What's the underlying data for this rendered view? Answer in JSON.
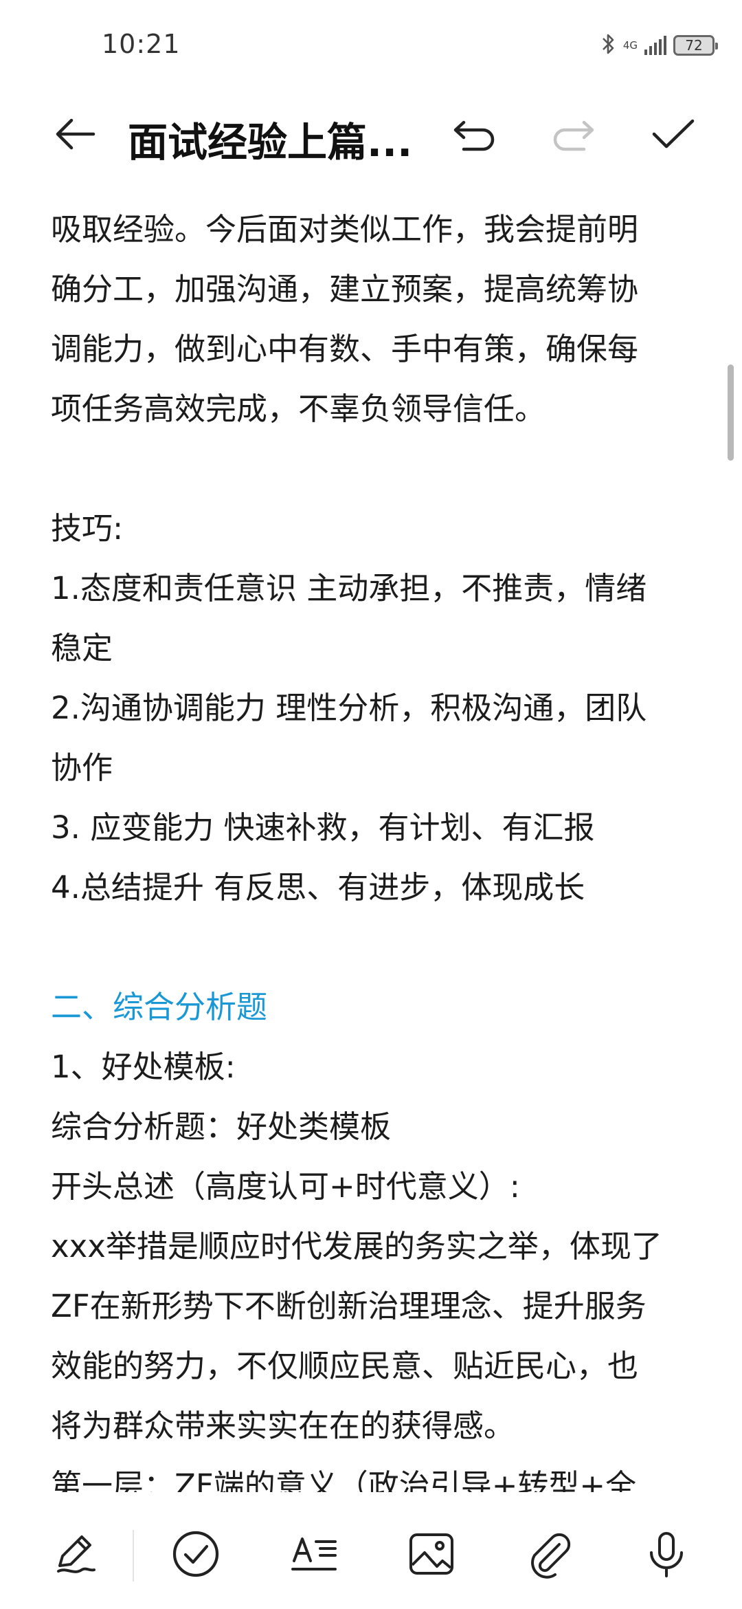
{
  "status_bar": {
    "time": "10:21",
    "network": "4G",
    "battery": "72",
    "icons": [
      "bluetooth-icon",
      "signal-icon",
      "battery-icon"
    ]
  },
  "toolbar": {
    "title": "面试经验上篇...",
    "icons": [
      "back-arrow-icon",
      "undo-icon",
      "redo-icon",
      "check-icon"
    ]
  },
  "note": {
    "heading_color": "#1a97d5",
    "lines": [
      "吸取经验。今后面对类似工作，我会提前明",
      "确分工，加强沟通，建立预案，提高统筹协",
      "调能力，做到心中有数、手中有策，确保每",
      "项任务高效完成，不辜负领导信任。",
      "",
      "技巧:",
      "1.态度和责任意识 主动承担，不推责，情绪",
      "稳定",
      "2.沟通协调能力 理性分析，积极沟通，团队",
      "协作",
      "3. 应变能力 快速补救，有计划、有汇报",
      "4.总结提升 有反思、有进步，体现成长",
      "",
      "二、综合分析题",
      "1、好处模板:",
      "综合分析题：好处类模板",
      "开头总述（高度认可+时代意义）:",
      "xxx举措是顺应时代发展的务实之举，体现了",
      "ZF在新形势下不断创新治理理念、提升服务",
      "效能的努力，不仅顺应民意、贴近民心，也",
      "将为群众带来实实在在的获得感。",
      "第一层：ZF端的意义（政治引导+转型+全"
    ]
  },
  "bottom_toolbar": {
    "icons": [
      "pen-icon",
      "checklist-icon",
      "text-format-icon",
      "image-icon",
      "attachment-icon",
      "microphone-icon"
    ]
  }
}
